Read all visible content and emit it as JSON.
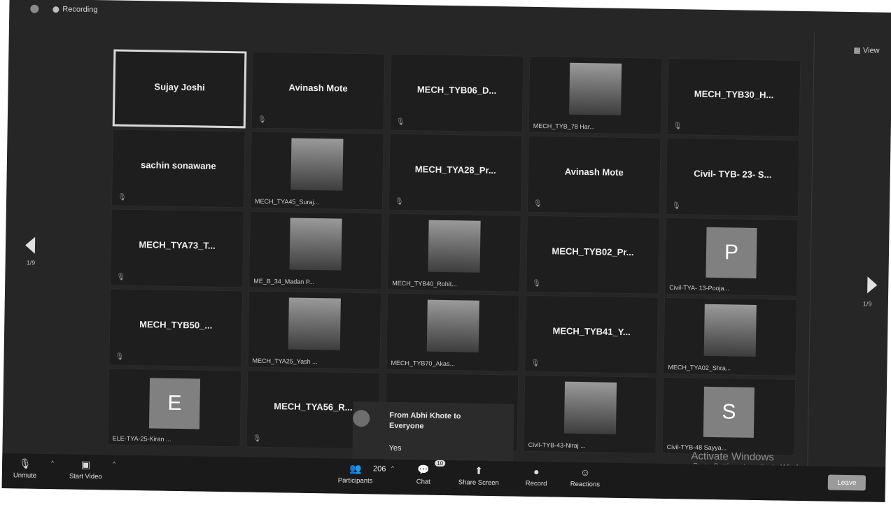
{
  "topbar": {
    "recording_label": "Recording",
    "view_label": "View"
  },
  "tiles": [
    {
      "name": "Sujay Joshi",
      "caption": "",
      "avatar": "",
      "active": true,
      "photo": false
    },
    {
      "name": "Avinash Mote",
      "caption": "",
      "avatar": "",
      "active": false,
      "photo": false
    },
    {
      "name": "MECH_TYB06_D...",
      "caption": "",
      "avatar": "",
      "active": false,
      "photo": false
    },
    {
      "name": "",
      "caption": "MECH_TYB_78 Har...",
      "avatar": "",
      "active": false,
      "photo": true
    },
    {
      "name": "MECH_TYB30_H...",
      "caption": "",
      "avatar": "",
      "active": false,
      "photo": false
    },
    {
      "name": "sachin sonawane",
      "caption": "",
      "avatar": "",
      "active": false,
      "photo": false
    },
    {
      "name": "",
      "caption": "MECH_TYA45_Suraj...",
      "avatar": "",
      "active": false,
      "photo": true
    },
    {
      "name": "MECH_TYA28_Pr...",
      "caption": "",
      "avatar": "",
      "active": false,
      "photo": false
    },
    {
      "name": "Avinash Mote",
      "caption": "",
      "avatar": "",
      "active": false,
      "photo": false
    },
    {
      "name": "Civil- TYB- 23- S...",
      "caption": "",
      "avatar": "",
      "active": false,
      "photo": false
    },
    {
      "name": "MECH_TYA73_T...",
      "caption": "",
      "avatar": "",
      "active": false,
      "photo": false
    },
    {
      "name": "",
      "caption": "ME_B_34_Madan P...",
      "avatar": "",
      "active": false,
      "photo": true
    },
    {
      "name": "",
      "caption": "MECH_TYB40_Rohit...",
      "avatar": "",
      "active": false,
      "photo": true
    },
    {
      "name": "MECH_TYB02_Pr...",
      "caption": "",
      "avatar": "",
      "active": false,
      "photo": false
    },
    {
      "name": "",
      "caption": "Civil-TYA- 13-Pooja...",
      "avatar": "P",
      "active": false,
      "photo": false
    },
    {
      "name": "MECH_TYB50_...",
      "caption": "",
      "avatar": "",
      "active": false,
      "photo": false
    },
    {
      "name": "",
      "caption": "MECH_TYA25_Yash ...",
      "avatar": "",
      "active": false,
      "photo": true
    },
    {
      "name": "",
      "caption": "MECH_TYB70_Akas...",
      "avatar": "",
      "active": false,
      "photo": true
    },
    {
      "name": "MECH_TYB41_Y...",
      "caption": "",
      "avatar": "",
      "active": false,
      "photo": false
    },
    {
      "name": "",
      "caption": "MECH_TYA02_Shra...",
      "avatar": "",
      "active": false,
      "photo": true
    },
    {
      "name": "",
      "caption": "ELE-TYA-25-Kiran ...",
      "avatar": "E",
      "active": false,
      "photo": false
    },
    {
      "name": "MECH_TYA56_R...",
      "caption": "",
      "avatar": "",
      "active": false,
      "photo": false
    },
    {
      "name": "",
      "caption": "",
      "avatar": "",
      "active": false,
      "photo": false
    },
    {
      "name": "",
      "caption": "Civil-TYB-43-Niraj ...",
      "avatar": "",
      "active": false,
      "photo": true
    },
    {
      "name": "",
      "caption": "Civil-TYB-48 Sayya...",
      "avatar": "S",
      "active": false,
      "photo": false
    }
  ],
  "pagination": {
    "left_label": "1/9",
    "right_label": "1/9"
  },
  "chat_popup": {
    "title_line1": "From Abhi Khote to",
    "title_line2": "Everyone",
    "message": "Yes"
  },
  "watermark": {
    "line1": "Activate Windows",
    "line2": "Go to Settings to activate Windows."
  },
  "toolbar": {
    "unmute": "Unmute",
    "start_video": "Start Video",
    "participants_count": "206",
    "participants": "Participants",
    "chat": "Chat",
    "chat_badge": "10",
    "share_screen": "Share Screen",
    "record": "Record",
    "reactions": "Reactions",
    "leave": "Leave"
  }
}
